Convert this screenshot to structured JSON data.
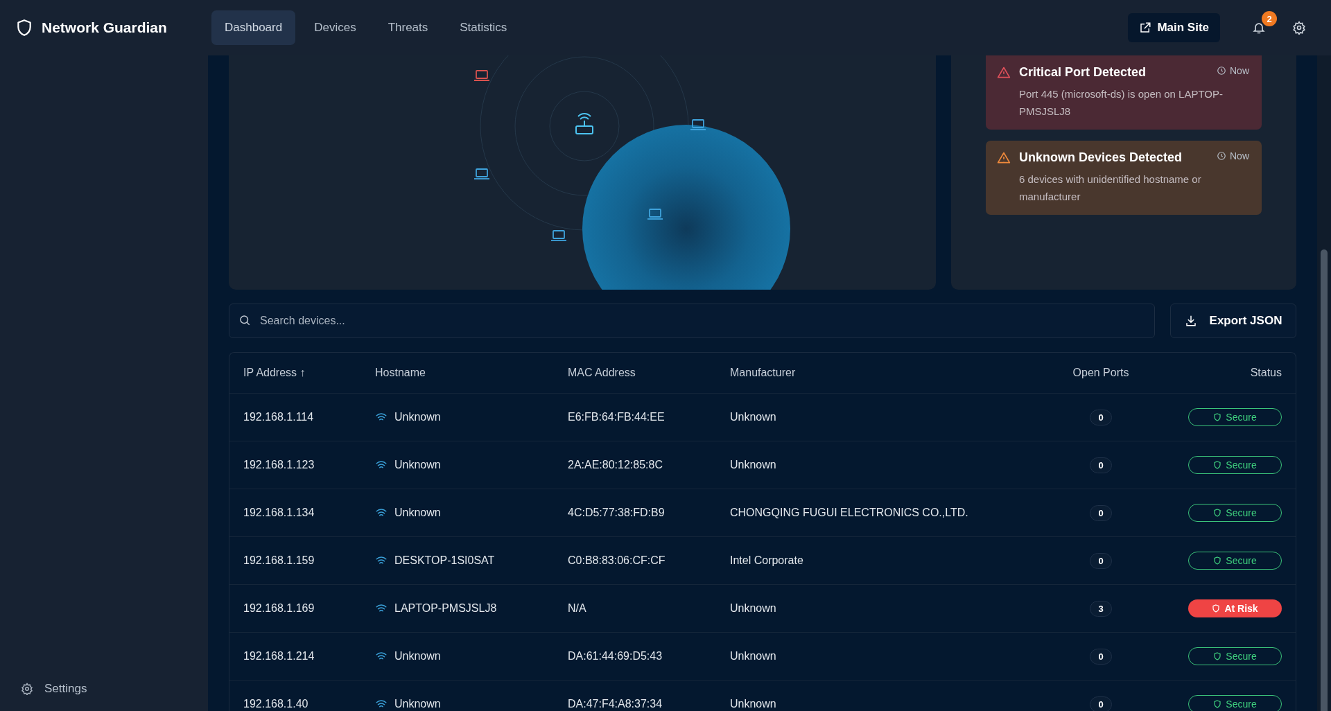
{
  "app": {
    "title": "Network Guardian"
  },
  "nav": [
    {
      "label": "Dashboard",
      "selected": true
    },
    {
      "label": "Devices",
      "selected": false
    },
    {
      "label": "Threats",
      "selected": false
    },
    {
      "label": "Statistics",
      "selected": false
    }
  ],
  "header": {
    "main_site": "Main Site",
    "notifications": "2"
  },
  "sidebar": {
    "settings": "Settings"
  },
  "map": {
    "nodes": [
      {
        "color": "#d9534f"
      },
      {
        "color": "#3fa3dc"
      },
      {
        "color": "#3fa3dc"
      },
      {
        "color": "#3fa3dc"
      },
      {
        "color": "#3fa3dc"
      }
    ]
  },
  "alerts": [
    {
      "kind": "critical",
      "title": "Critical Port Detected",
      "time": "Now",
      "message": "Port 445 (microsoft-ds) is open on LAPTOP-PMSJSLJ8"
    },
    {
      "kind": "warning",
      "title": "Unknown Devices Detected",
      "time": "Now",
      "message": "6 devices with unidentified hostname or manufacturer"
    }
  ],
  "search": {
    "placeholder": "Search devices..."
  },
  "export_button": "Export JSON",
  "table": {
    "columns": [
      "IP Address ↑",
      "Hostname",
      "MAC Address",
      "Manufacturer",
      "Open Ports",
      "Status"
    ],
    "rows": [
      {
        "ip": "192.168.1.114",
        "hostname": "Unknown",
        "mac": "E6:FB:64:FB:44:EE",
        "manufacturer": "Unknown",
        "open_ports": "0",
        "at_risk": false,
        "status_label": "Secure"
      },
      {
        "ip": "192.168.1.123",
        "hostname": "Unknown",
        "mac": "2A:AE:80:12:85:8C",
        "manufacturer": "Unknown",
        "open_ports": "0",
        "at_risk": false,
        "status_label": "Secure"
      },
      {
        "ip": "192.168.1.134",
        "hostname": "Unknown",
        "mac": "4C:D5:77:38:FD:B9",
        "manufacturer": "CHONGQING FUGUI ELECTRONICS CO.,LTD.",
        "open_ports": "0",
        "at_risk": false,
        "status_label": "Secure"
      },
      {
        "ip": "192.168.1.159",
        "hostname": "DESKTOP-1SI0SAT",
        "mac": "C0:B8:83:06:CF:CF",
        "manufacturer": "Intel Corporate",
        "open_ports": "0",
        "at_risk": false,
        "status_label": "Secure"
      },
      {
        "ip": "192.168.1.169",
        "hostname": "LAPTOP-PMSJSLJ8",
        "mac": "N/A",
        "manufacturer": "Unknown",
        "open_ports": "3",
        "at_risk": true,
        "status_label": "At Risk"
      },
      {
        "ip": "192.168.1.214",
        "hostname": "Unknown",
        "mac": "DA:61:44:69:D5:43",
        "manufacturer": "Unknown",
        "open_ports": "0",
        "at_risk": false,
        "status_label": "Secure"
      },
      {
        "ip": "192.168.1.40",
        "hostname": "Unknown",
        "mac": "DA:47:F4:A8:37:34",
        "manufacturer": "Unknown",
        "open_ports": "0",
        "at_risk": false,
        "status_label": "Secure"
      }
    ]
  }
}
